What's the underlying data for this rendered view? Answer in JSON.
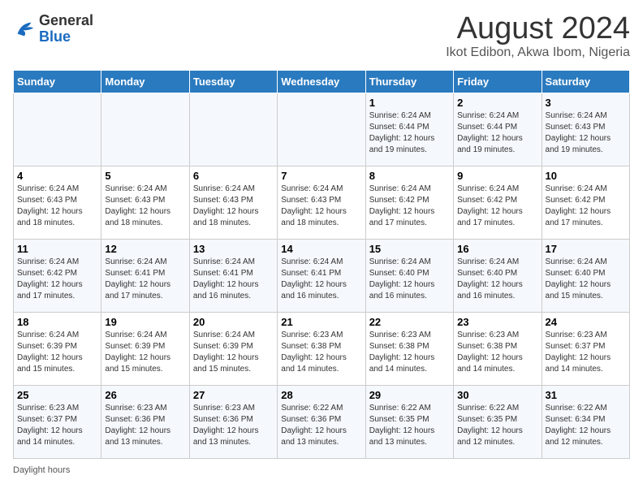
{
  "header": {
    "logo_general": "General",
    "logo_blue": "Blue",
    "month_year": "August 2024",
    "location": "Ikot Edibon, Akwa Ibom, Nigeria"
  },
  "days_of_week": [
    "Sunday",
    "Monday",
    "Tuesday",
    "Wednesday",
    "Thursday",
    "Friday",
    "Saturday"
  ],
  "weeks": [
    [
      {
        "day": "",
        "info": ""
      },
      {
        "day": "",
        "info": ""
      },
      {
        "day": "",
        "info": ""
      },
      {
        "day": "",
        "info": ""
      },
      {
        "day": "1",
        "info": "Sunrise: 6:24 AM\nSunset: 6:44 PM\nDaylight: 12 hours and 19 minutes."
      },
      {
        "day": "2",
        "info": "Sunrise: 6:24 AM\nSunset: 6:44 PM\nDaylight: 12 hours and 19 minutes."
      },
      {
        "day": "3",
        "info": "Sunrise: 6:24 AM\nSunset: 6:43 PM\nDaylight: 12 hours and 19 minutes."
      }
    ],
    [
      {
        "day": "4",
        "info": "Sunrise: 6:24 AM\nSunset: 6:43 PM\nDaylight: 12 hours and 18 minutes."
      },
      {
        "day": "5",
        "info": "Sunrise: 6:24 AM\nSunset: 6:43 PM\nDaylight: 12 hours and 18 minutes."
      },
      {
        "day": "6",
        "info": "Sunrise: 6:24 AM\nSunset: 6:43 PM\nDaylight: 12 hours and 18 minutes."
      },
      {
        "day": "7",
        "info": "Sunrise: 6:24 AM\nSunset: 6:43 PM\nDaylight: 12 hours and 18 minutes."
      },
      {
        "day": "8",
        "info": "Sunrise: 6:24 AM\nSunset: 6:42 PM\nDaylight: 12 hours and 17 minutes."
      },
      {
        "day": "9",
        "info": "Sunrise: 6:24 AM\nSunset: 6:42 PM\nDaylight: 12 hours and 17 minutes."
      },
      {
        "day": "10",
        "info": "Sunrise: 6:24 AM\nSunset: 6:42 PM\nDaylight: 12 hours and 17 minutes."
      }
    ],
    [
      {
        "day": "11",
        "info": "Sunrise: 6:24 AM\nSunset: 6:42 PM\nDaylight: 12 hours and 17 minutes."
      },
      {
        "day": "12",
        "info": "Sunrise: 6:24 AM\nSunset: 6:41 PM\nDaylight: 12 hours and 17 minutes."
      },
      {
        "day": "13",
        "info": "Sunrise: 6:24 AM\nSunset: 6:41 PM\nDaylight: 12 hours and 16 minutes."
      },
      {
        "day": "14",
        "info": "Sunrise: 6:24 AM\nSunset: 6:41 PM\nDaylight: 12 hours and 16 minutes."
      },
      {
        "day": "15",
        "info": "Sunrise: 6:24 AM\nSunset: 6:40 PM\nDaylight: 12 hours and 16 minutes."
      },
      {
        "day": "16",
        "info": "Sunrise: 6:24 AM\nSunset: 6:40 PM\nDaylight: 12 hours and 16 minutes."
      },
      {
        "day": "17",
        "info": "Sunrise: 6:24 AM\nSunset: 6:40 PM\nDaylight: 12 hours and 15 minutes."
      }
    ],
    [
      {
        "day": "18",
        "info": "Sunrise: 6:24 AM\nSunset: 6:39 PM\nDaylight: 12 hours and 15 minutes."
      },
      {
        "day": "19",
        "info": "Sunrise: 6:24 AM\nSunset: 6:39 PM\nDaylight: 12 hours and 15 minutes."
      },
      {
        "day": "20",
        "info": "Sunrise: 6:24 AM\nSunset: 6:39 PM\nDaylight: 12 hours and 15 minutes."
      },
      {
        "day": "21",
        "info": "Sunrise: 6:23 AM\nSunset: 6:38 PM\nDaylight: 12 hours and 14 minutes."
      },
      {
        "day": "22",
        "info": "Sunrise: 6:23 AM\nSunset: 6:38 PM\nDaylight: 12 hours and 14 minutes."
      },
      {
        "day": "23",
        "info": "Sunrise: 6:23 AM\nSunset: 6:38 PM\nDaylight: 12 hours and 14 minutes."
      },
      {
        "day": "24",
        "info": "Sunrise: 6:23 AM\nSunset: 6:37 PM\nDaylight: 12 hours and 14 minutes."
      }
    ],
    [
      {
        "day": "25",
        "info": "Sunrise: 6:23 AM\nSunset: 6:37 PM\nDaylight: 12 hours and 14 minutes."
      },
      {
        "day": "26",
        "info": "Sunrise: 6:23 AM\nSunset: 6:36 PM\nDaylight: 12 hours and 13 minutes."
      },
      {
        "day": "27",
        "info": "Sunrise: 6:23 AM\nSunset: 6:36 PM\nDaylight: 12 hours and 13 minutes."
      },
      {
        "day": "28",
        "info": "Sunrise: 6:22 AM\nSunset: 6:36 PM\nDaylight: 12 hours and 13 minutes."
      },
      {
        "day": "29",
        "info": "Sunrise: 6:22 AM\nSunset: 6:35 PM\nDaylight: 12 hours and 13 minutes."
      },
      {
        "day": "30",
        "info": "Sunrise: 6:22 AM\nSunset: 6:35 PM\nDaylight: 12 hours and 12 minutes."
      },
      {
        "day": "31",
        "info": "Sunrise: 6:22 AM\nSunset: 6:34 PM\nDaylight: 12 hours and 12 minutes."
      }
    ]
  ],
  "footer": {
    "daylight_label": "Daylight hours"
  }
}
